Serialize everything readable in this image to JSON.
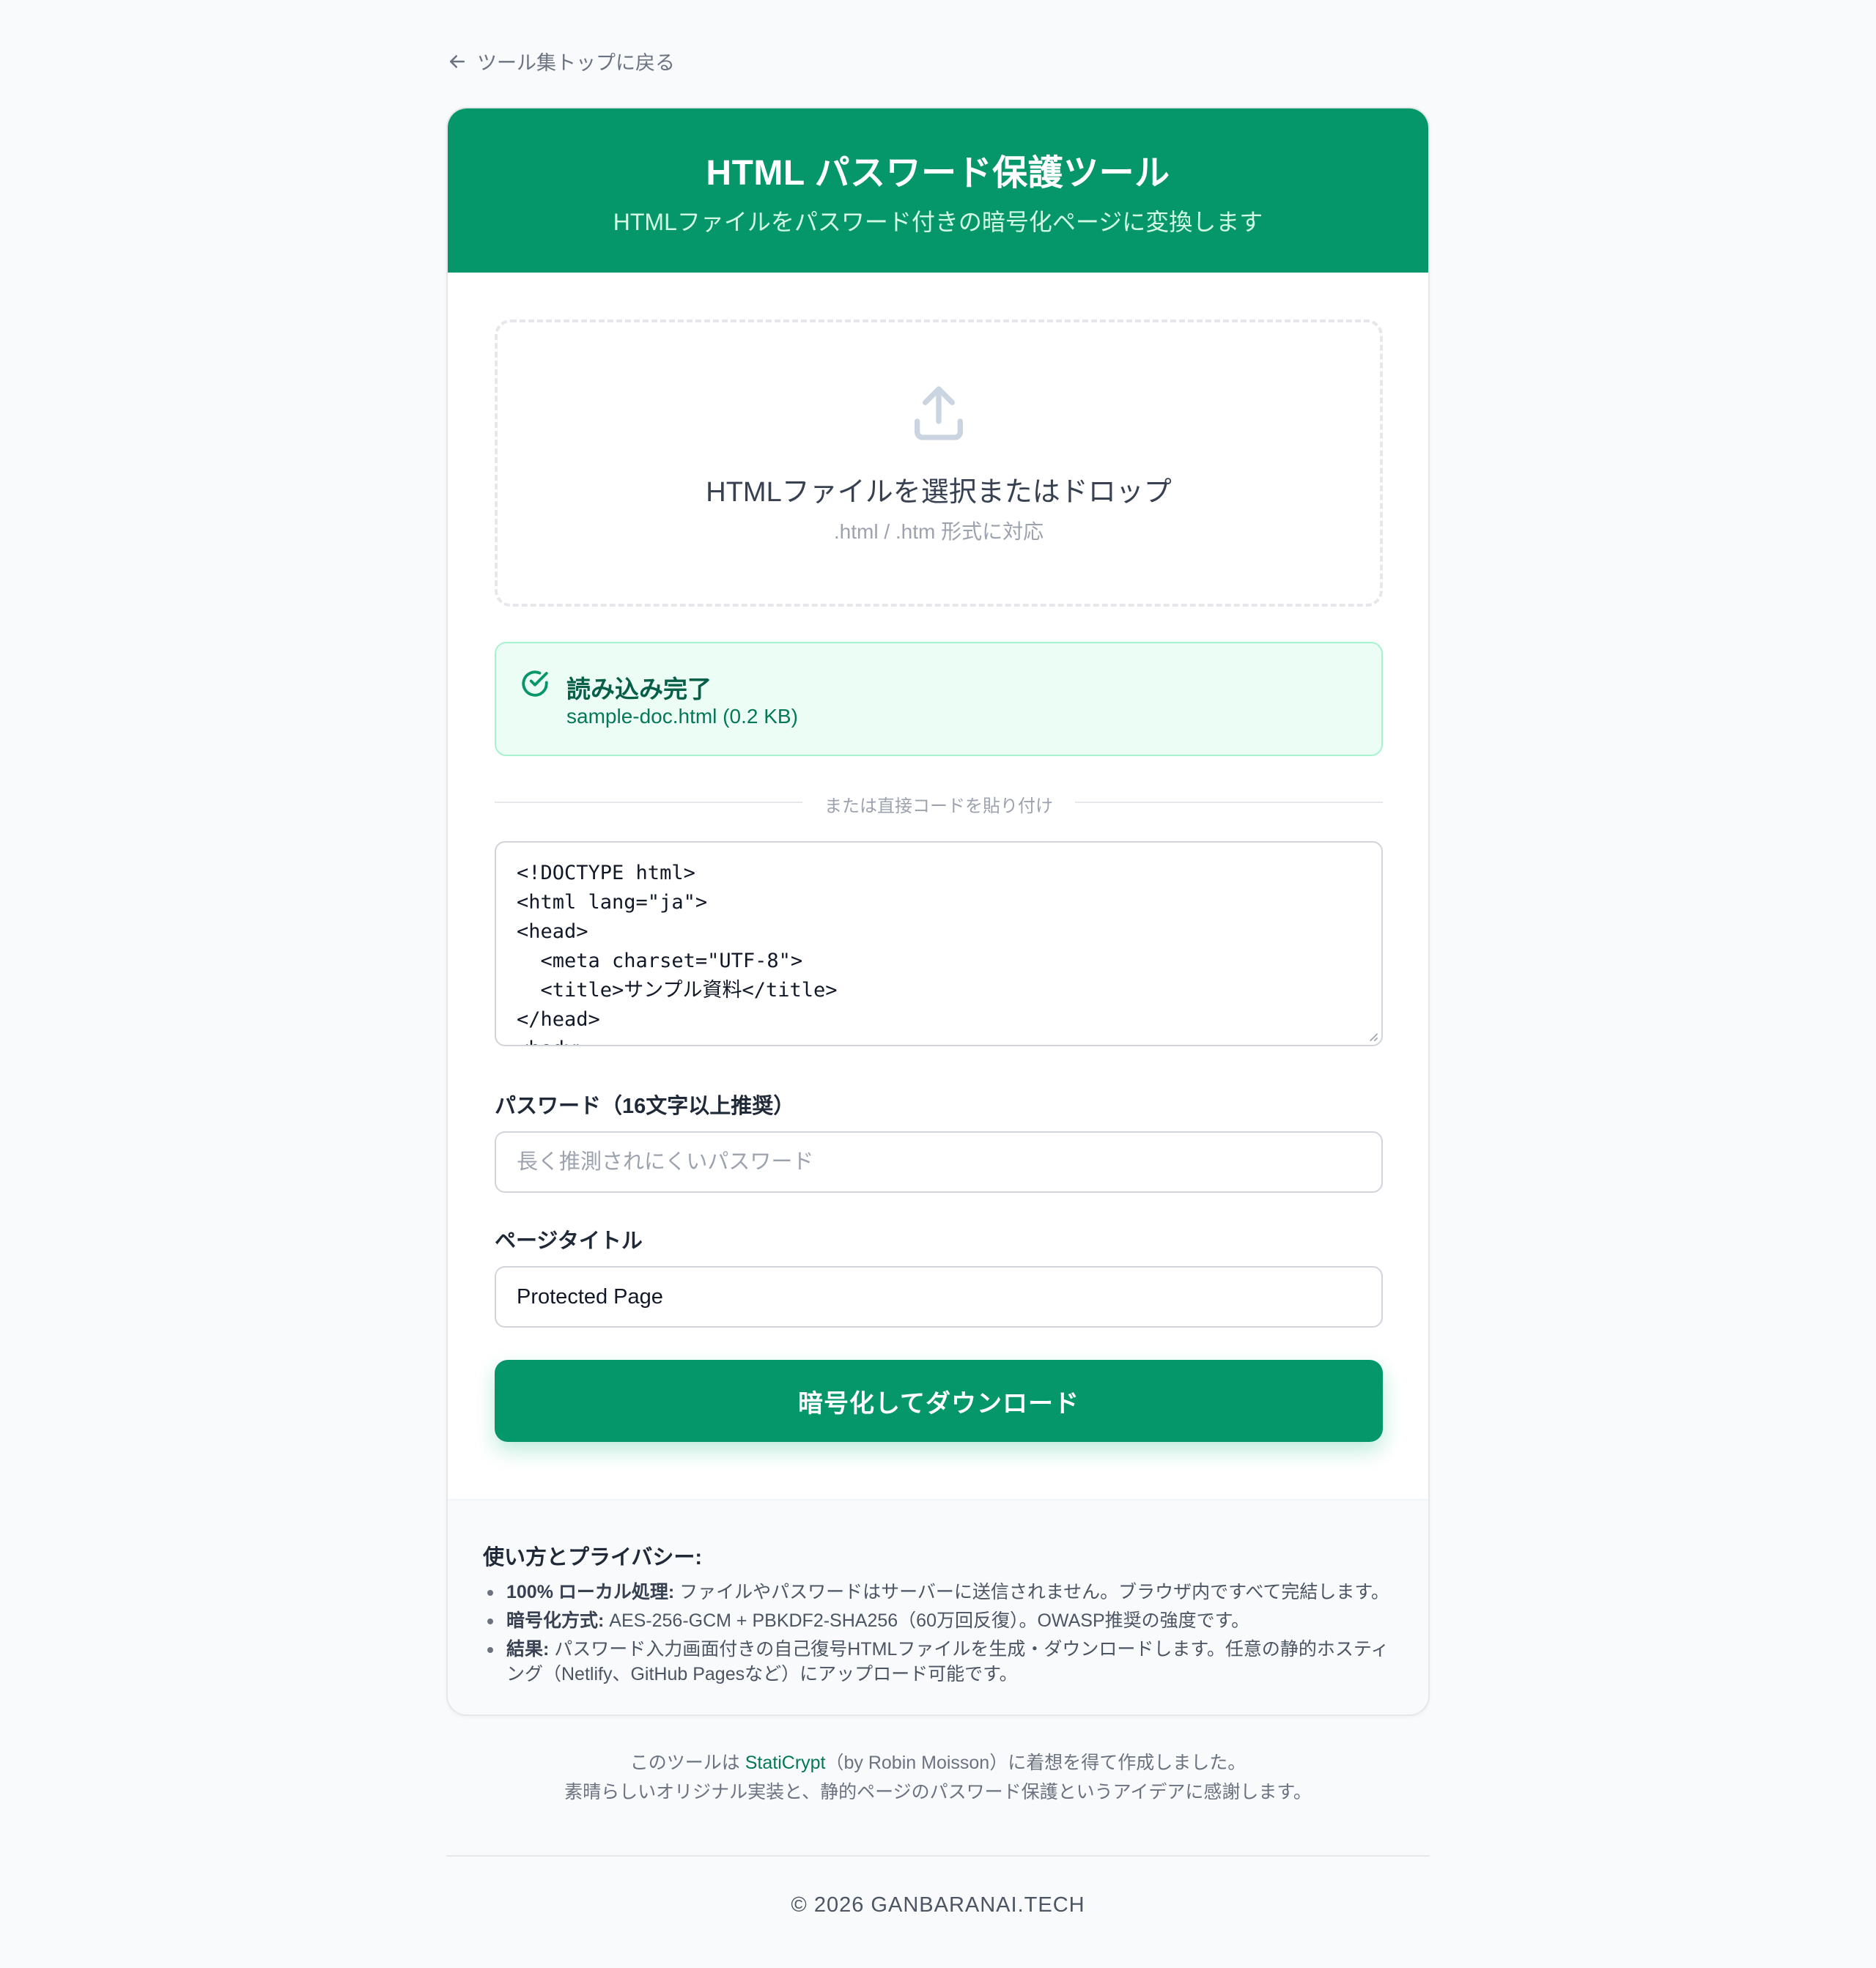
{
  "nav": {
    "back_label": "ツール集トップに戻る"
  },
  "header": {
    "title": "HTML パスワード保護ツール",
    "subtitle": "HTMLファイルをパスワード付きの暗号化ページに変換します"
  },
  "dropzone": {
    "title": "HTMLファイルを選択またはドロップ",
    "subtitle": ".html / .htm 形式に対応"
  },
  "status": {
    "title": "読み込み完了",
    "file": "sample-doc.html (0.2 KB)"
  },
  "divider": {
    "text": "または直接コードを貼り付け"
  },
  "code": {
    "value": "<!DOCTYPE html>\n<html lang=\"ja\">\n<head>\n  <meta charset=\"UTF-8\">\n  <title>サンプル資料</title>\n</head>\n<body>"
  },
  "password": {
    "label": "パスワード（16文字以上推奨）",
    "placeholder": "長く推測されにくいパスワード",
    "value": ""
  },
  "page_title": {
    "label": "ページタイトル",
    "value": "Protected Page"
  },
  "submit": {
    "label": "暗号化してダウンロード"
  },
  "info": {
    "heading": "使い方とプライバシー:",
    "items": [
      {
        "title": "100% ローカル処理:",
        "text": " ファイルやパスワードはサーバーに送信されません。ブラウザ内ですべて完結します。"
      },
      {
        "title": "暗号化方式:",
        "text": " AES-256-GCM + PBKDF2-SHA256（60万回反復）。OWASP推奨の強度です。"
      },
      {
        "title": "結果:",
        "text": " パスワード入力画面付きの自己復号HTMLファイルを生成・ダウンロードします。任意の静的ホスティング（Netlify、GitHub Pagesなど）にアップロード可能です。"
      }
    ]
  },
  "credit": {
    "prefix": "このツールは ",
    "link": "StatiCrypt",
    "suffix": "（by Robin Moisson）に着想を得て作成しました。",
    "line2": "素晴らしいオリジナル実装と、静的ページのパスワード保護というアイデアに感謝します。"
  },
  "footer": {
    "copyright": "© 2026 GANBARANAI.TECH"
  },
  "colors": {
    "brand": "#059669",
    "success_bg": "#ecfdf5",
    "success_text": "#065f46"
  },
  "icons": {
    "back": "arrow-left-icon",
    "upload": "upload-icon",
    "status": "check-circle-icon"
  }
}
